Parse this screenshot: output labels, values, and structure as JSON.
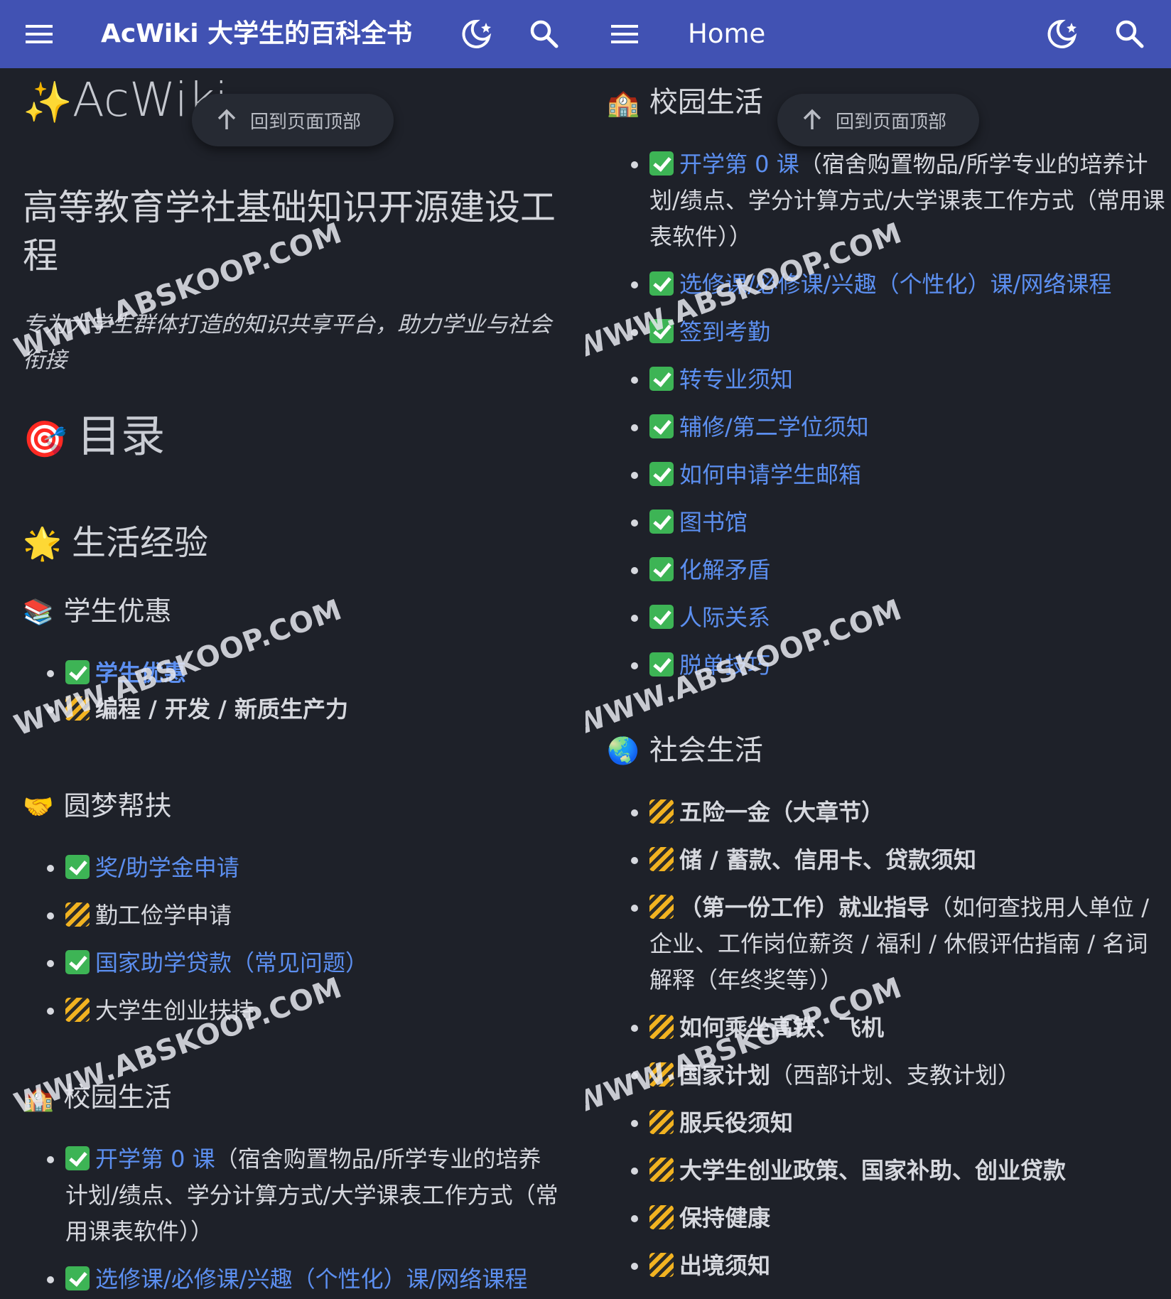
{
  "left": {
    "topbar": {
      "title": "AcWiki 大学生的百科全书"
    },
    "back_to_top": "回到页面顶部",
    "brand": "AcWiki",
    "headline": "高等教育学社基础知识开源建设工程",
    "tagline": "专为大学生群体打造的知识共享平台，助力学业与社会衔接",
    "toc_heading": "目录",
    "section_life": "生活经验",
    "sub_discount": "学生优惠",
    "discount_items": [
      "学生优惠",
      "编程 / 开发 / 新质生产力"
    ],
    "sub_support": "圆梦帮扶",
    "support_items": [
      "奖/助学金申请",
      "勤工俭学申请",
      "国家助学贷款（常见问题）",
      "大学生创业扶持"
    ],
    "sub_campus": "校园生活",
    "campus_items": [
      {
        "link": "开学第 0 课",
        "desc": "（宿舍购置物品/所学专业的培养计划/绩点、学分计算方式/大学课表工作方式（常用课表软件））"
      },
      {
        "link": "选修课/必修课/兴趣（个性化）课/网络课程",
        "desc": ""
      }
    ]
  },
  "right": {
    "topbar": {
      "title": "Home"
    },
    "back_to_top": "回到页面顶部",
    "sub_campus": "校园生活",
    "campus_items": [
      {
        "link": "开学第 0 课",
        "desc": "（宿舍购置物品/所学专业的培养计划/绩点、学分计算方式/大学课表工作方式（常用课表软件））"
      },
      {
        "link": "选修课/必修课/兴趣（个性化）课/网络课程",
        "desc": ""
      },
      {
        "link": "签到考勤",
        "desc": ""
      },
      {
        "link": "转专业须知",
        "desc": ""
      },
      {
        "link": "辅修/第二学位须知",
        "desc": ""
      },
      {
        "link": "如何申请学生邮箱",
        "desc": ""
      },
      {
        "link": "图书馆",
        "desc": ""
      },
      {
        "link": "化解矛盾",
        "desc": ""
      },
      {
        "link": "人际关系",
        "desc": ""
      },
      {
        "link": "脱单技巧",
        "desc": ""
      }
    ],
    "sub_society": "社会生活",
    "society_items": [
      {
        "bold": "五险一金（大章节）",
        "desc": ""
      },
      {
        "bold": "储 / 蓄款、信用卡、贷款须知",
        "desc": ""
      },
      {
        "bold": "（第一份工作）就业指导",
        "desc": "（如何查找用人单位 / 企业、工作岗位薪资 / 福利 / 休假评估指南 / 名词解释（年终奖等））"
      },
      {
        "bold": "如何乘坐高铁、飞机",
        "desc": ""
      },
      {
        "bold": "国家计划",
        "desc": "（西部计划、支教计划）"
      },
      {
        "bold": "服兵役须知",
        "desc": ""
      },
      {
        "bold": "大学生创业政策、国家补助、创业贷款",
        "desc": ""
      },
      {
        "bold": "保持健康",
        "desc": ""
      },
      {
        "bold": "出境须知",
        "desc": ""
      }
    ]
  },
  "watermark": "WWW.ABSKOOP.COM",
  "icons": {
    "menu": "menu-icon",
    "moon": "moon-icon",
    "search": "search-icon",
    "arrow": "arrow-up-icon",
    "check": "check-icon",
    "construction": "construction-icon"
  },
  "colors": {
    "topbar": "#4152b3",
    "background": "#1e2129",
    "link": "#5c8ff0",
    "check": "#3db455"
  }
}
